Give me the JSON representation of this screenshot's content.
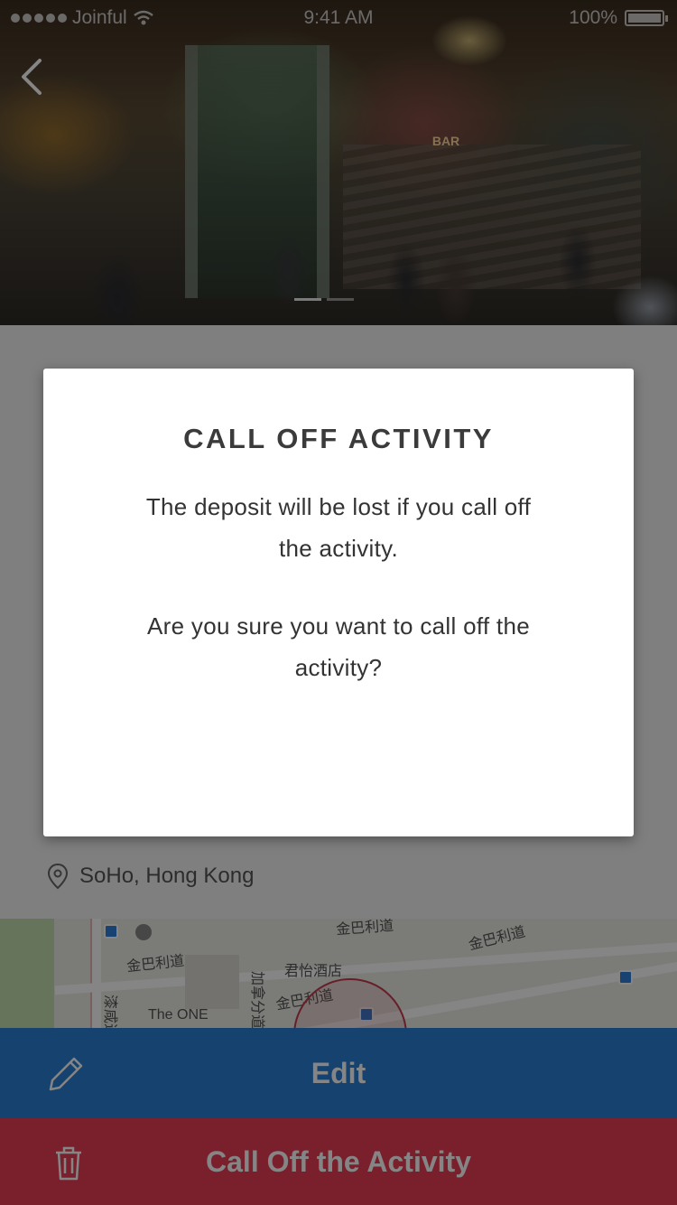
{
  "status_bar": {
    "carrier": "Joinful",
    "time": "9:41 AM",
    "battery": "100%"
  },
  "hero": {
    "sign_text": "BAR",
    "photo_count": 2,
    "active_photo": 1
  },
  "location": {
    "label": "SoHo, Hong Kong"
  },
  "map": {
    "labels": {
      "street1": "金巴利道",
      "street2": "金巴利道",
      "street3": "金巴利道",
      "hotel": "君怡酒店",
      "road_v": "加拿分道",
      "building": "The ONE",
      "road_left": "漆咸道",
      "top_street": "金巴利道"
    }
  },
  "actions": {
    "edit_label": "Edit",
    "call_off_label": "Call Off the Activity"
  },
  "modal": {
    "title": "CALL OFF ACTIVITY",
    "message": "The deposit will be lost if you call off the activity.",
    "question": "Are you sure you want to call off the activity?"
  },
  "colors": {
    "edit_blue": "#2a7fd4",
    "call_off_red": "#e83e55",
    "map_pin": "#c63a4c"
  }
}
